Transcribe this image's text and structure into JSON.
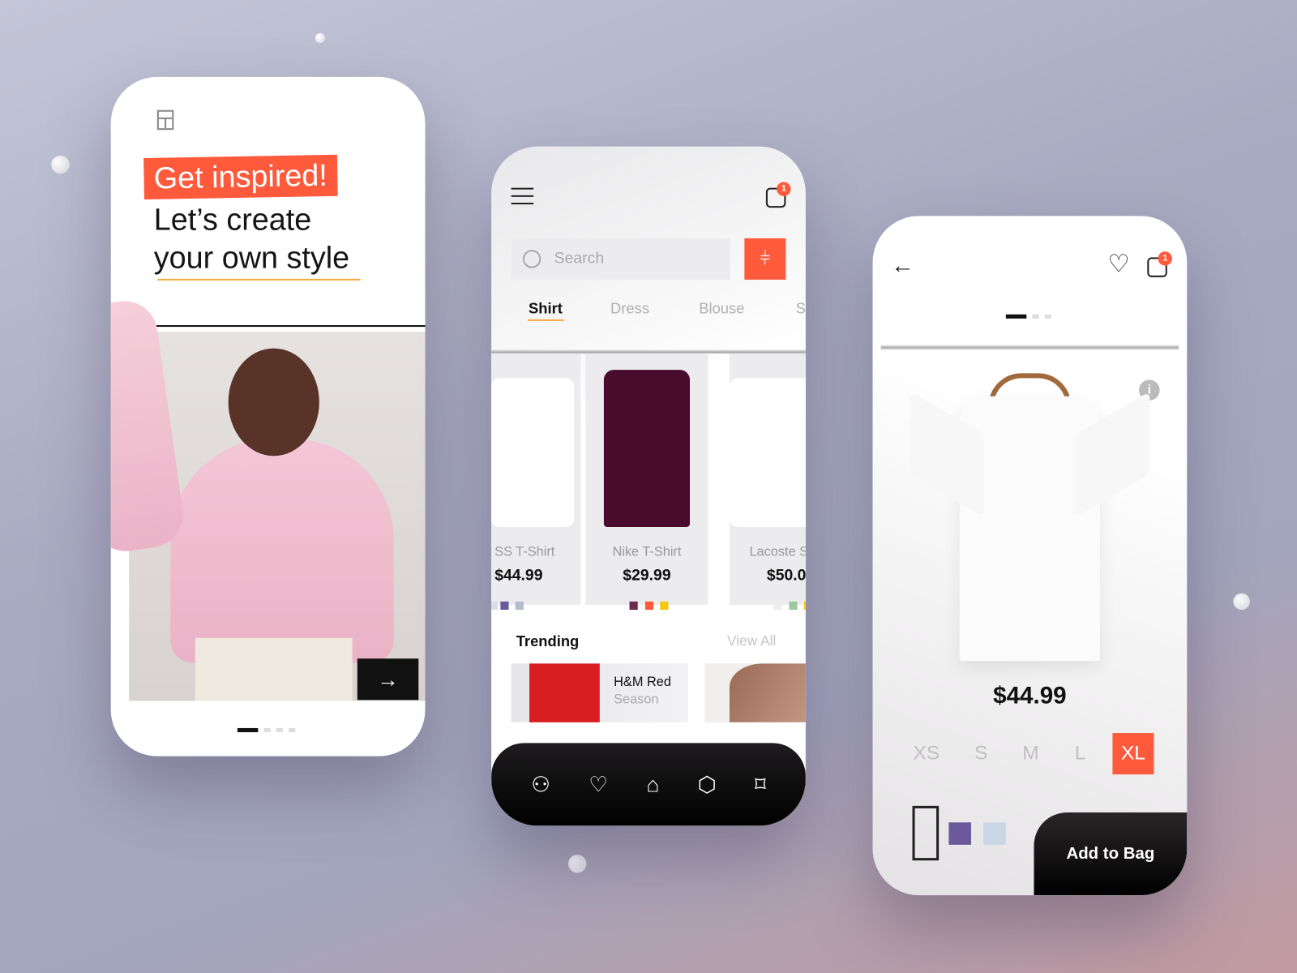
{
  "colors": {
    "accent": "#ff5a3c",
    "dark": "#111111"
  },
  "onboarding": {
    "logo_icon": "wardrobe-icon",
    "headline_highlight": "Get inspired!",
    "headline_line2": "Let’s create",
    "headline_line3": "your own style",
    "next_icon": "arrow-right-icon",
    "pager": {
      "pages": 4,
      "active": 1
    }
  },
  "shop": {
    "menu_icon": "hamburger-icon",
    "cart_badge": "1",
    "search_placeholder": "Search",
    "filter_icon": "sliders-icon",
    "tabs": [
      {
        "label": "Shirt",
        "active": true
      },
      {
        "label": "Dress"
      },
      {
        "label": "Blouse"
      },
      {
        "label": "S"
      }
    ],
    "products": [
      {
        "name": "SS T-Shirt",
        "price": "$44.99",
        "swatches": [
          "#dcdce4",
          "#6a5a9c",
          "#b4bdd0"
        ]
      },
      {
        "name": "Nike T-Shirt",
        "price": "$29.99",
        "swatches": [
          "#6b2b4a",
          "#ff5a3c",
          "#f6c90e"
        ]
      },
      {
        "name": "Lacoste S",
        "price": "$50.0",
        "swatches": [
          "#eeeeee",
          "#9ccaa0",
          "#f6c90e"
        ]
      }
    ],
    "trending_title": "Trending",
    "view_all": "View All",
    "trending": [
      {
        "title": "H&M Red",
        "subtitle": "Season"
      },
      {
        "title": "",
        "subtitle": ""
      }
    ],
    "nav_icons": [
      "user-icon",
      "heart-icon",
      "home-icon",
      "box-icon",
      "tag-icon"
    ],
    "nav_active": "home-icon"
  },
  "detail": {
    "back_icon": "arrow-left-icon",
    "cart_badge": "1",
    "pager": {
      "pages": 3,
      "active": 1
    },
    "price": "$44.99",
    "sizes": [
      "XS",
      "S",
      "M",
      "L",
      "XL"
    ],
    "selected_size": "XL",
    "colors": [
      "#ffffff",
      "#6a5a9c",
      "#c8d6e6"
    ],
    "add_to_bag": "Add to Bag"
  }
}
